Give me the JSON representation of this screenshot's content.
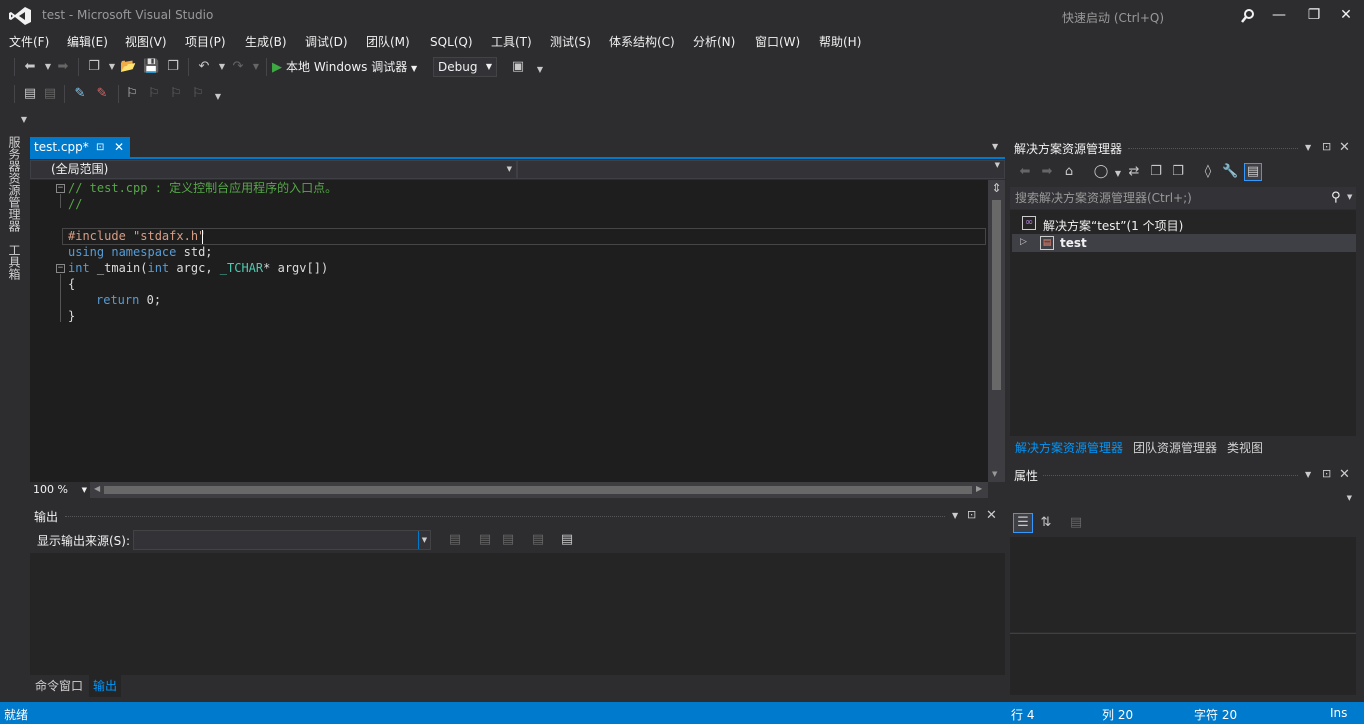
{
  "window": {
    "title": "test - Microsoft Visual Studio",
    "quick_launch": "快速启动 (Ctrl+Q)"
  },
  "menu": [
    "文件(F)",
    "编辑(E)",
    "视图(V)",
    "项目(P)",
    "生成(B)",
    "调试(D)",
    "团队(M)",
    "SQL(Q)",
    "工具(T)",
    "测试(S)",
    "体系结构(C)",
    "分析(N)",
    "窗口(W)",
    "帮助(H)"
  ],
  "toolbar": {
    "run_label": "本地 Windows 调试器",
    "config": "Debug"
  },
  "left_tabs": [
    "服务器资源管理器",
    "工具箱"
  ],
  "editor": {
    "tab_label": "test.cpp*",
    "scope": "(全局范围)",
    "zoom": "100 %",
    "lines": {
      "l1": "// test.cpp : 定义控制台应用程序的入口点。",
      "l2": "//",
      "l4": "#include \"stdafx.h\"",
      "l5a": "using",
      "l5b": "namespace",
      "l5c": "std;",
      "l6a": "int",
      "l6b": "_tmain(",
      "l6c": "int",
      "l6d": "argc, ",
      "l6e": "_TCHAR",
      "l6f": "* argv[])",
      "l7": "{",
      "l8a": "return",
      "l8b": "0;",
      "l9": "}"
    }
  },
  "output": {
    "title": "输出",
    "source_label": "显示输出来源(S):",
    "tabs": [
      "命令窗口",
      "输出"
    ]
  },
  "solution_explorer": {
    "title": "解决方案资源管理器",
    "search_placeholder": "搜索解决方案资源管理器(Ctrl+;)",
    "solution_node": "解决方案“test”(1 个项目)",
    "project_node": "test",
    "tabs": [
      "解决方案资源管理器",
      "团队资源管理器",
      "类视图"
    ]
  },
  "properties": {
    "title": "属性"
  },
  "status": {
    "ready": "就绪",
    "line": "行 4",
    "col": "列 20",
    "char": "字符 20",
    "mode": "Ins"
  },
  "colors": {
    "accent": "#007acc",
    "background": "#2d2d30",
    "editor": "#1e1e1e",
    "panel": "#252526"
  }
}
